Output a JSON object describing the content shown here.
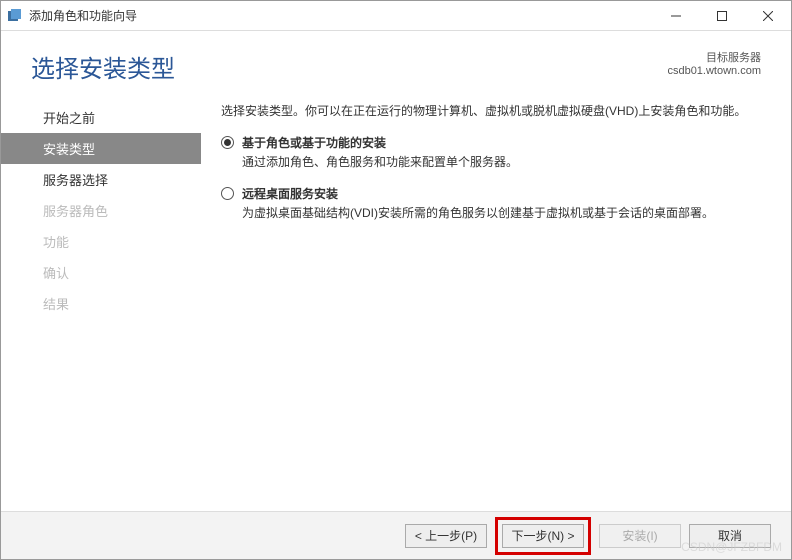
{
  "window": {
    "title": "添加角色和功能向导"
  },
  "header": {
    "page_title": "选择安装类型",
    "target_label": "目标服务器",
    "target_value": "csdb01.wtown.com"
  },
  "sidebar": {
    "items": [
      {
        "label": "开始之前",
        "state": "enabled"
      },
      {
        "label": "安装类型",
        "state": "active"
      },
      {
        "label": "服务器选择",
        "state": "enabled"
      },
      {
        "label": "服务器角色",
        "state": "disabled"
      },
      {
        "label": "功能",
        "state": "disabled"
      },
      {
        "label": "确认",
        "state": "disabled"
      },
      {
        "label": "结果",
        "state": "disabled"
      }
    ]
  },
  "main": {
    "intro": "选择安装类型。你可以在正在运行的物理计算机、虚拟机或脱机虚拟硬盘(VHD)上安装角色和功能。",
    "option1": {
      "title": "基于角色或基于功能的安装",
      "desc": "通过添加角色、角色服务和功能来配置单个服务器。"
    },
    "option2": {
      "title": "远程桌面服务安装",
      "desc": "为虚拟桌面基础结构(VDI)安装所需的角色服务以创建基于虚拟机或基于会话的桌面部署。"
    }
  },
  "footer": {
    "prev": "< 上一步(P)",
    "next": "下一步(N) >",
    "install": "安装(I)",
    "cancel": "取消"
  },
  "watermark": "CSDN@JFZBFDM"
}
